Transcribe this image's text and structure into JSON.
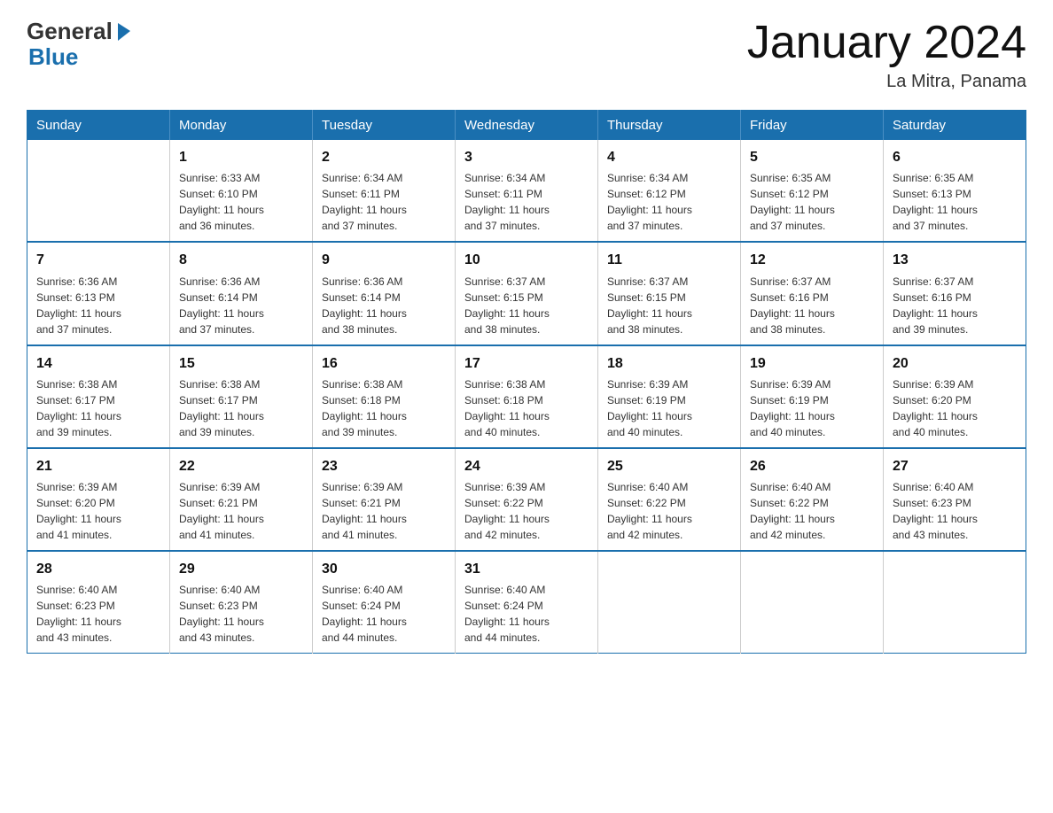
{
  "logo": {
    "general": "General",
    "blue": "Blue",
    "arrow": "▶"
  },
  "title": "January 2024",
  "subtitle": "La Mitra, Panama",
  "headers": [
    "Sunday",
    "Monday",
    "Tuesday",
    "Wednesday",
    "Thursday",
    "Friday",
    "Saturday"
  ],
  "weeks": [
    [
      {
        "day": "",
        "info": ""
      },
      {
        "day": "1",
        "info": "Sunrise: 6:33 AM\nSunset: 6:10 PM\nDaylight: 11 hours\nand 36 minutes."
      },
      {
        "day": "2",
        "info": "Sunrise: 6:34 AM\nSunset: 6:11 PM\nDaylight: 11 hours\nand 37 minutes."
      },
      {
        "day": "3",
        "info": "Sunrise: 6:34 AM\nSunset: 6:11 PM\nDaylight: 11 hours\nand 37 minutes."
      },
      {
        "day": "4",
        "info": "Sunrise: 6:34 AM\nSunset: 6:12 PM\nDaylight: 11 hours\nand 37 minutes."
      },
      {
        "day": "5",
        "info": "Sunrise: 6:35 AM\nSunset: 6:12 PM\nDaylight: 11 hours\nand 37 minutes."
      },
      {
        "day": "6",
        "info": "Sunrise: 6:35 AM\nSunset: 6:13 PM\nDaylight: 11 hours\nand 37 minutes."
      }
    ],
    [
      {
        "day": "7",
        "info": "Sunrise: 6:36 AM\nSunset: 6:13 PM\nDaylight: 11 hours\nand 37 minutes."
      },
      {
        "day": "8",
        "info": "Sunrise: 6:36 AM\nSunset: 6:14 PM\nDaylight: 11 hours\nand 37 minutes."
      },
      {
        "day": "9",
        "info": "Sunrise: 6:36 AM\nSunset: 6:14 PM\nDaylight: 11 hours\nand 38 minutes."
      },
      {
        "day": "10",
        "info": "Sunrise: 6:37 AM\nSunset: 6:15 PM\nDaylight: 11 hours\nand 38 minutes."
      },
      {
        "day": "11",
        "info": "Sunrise: 6:37 AM\nSunset: 6:15 PM\nDaylight: 11 hours\nand 38 minutes."
      },
      {
        "day": "12",
        "info": "Sunrise: 6:37 AM\nSunset: 6:16 PM\nDaylight: 11 hours\nand 38 minutes."
      },
      {
        "day": "13",
        "info": "Sunrise: 6:37 AM\nSunset: 6:16 PM\nDaylight: 11 hours\nand 39 minutes."
      }
    ],
    [
      {
        "day": "14",
        "info": "Sunrise: 6:38 AM\nSunset: 6:17 PM\nDaylight: 11 hours\nand 39 minutes."
      },
      {
        "day": "15",
        "info": "Sunrise: 6:38 AM\nSunset: 6:17 PM\nDaylight: 11 hours\nand 39 minutes."
      },
      {
        "day": "16",
        "info": "Sunrise: 6:38 AM\nSunset: 6:18 PM\nDaylight: 11 hours\nand 39 minutes."
      },
      {
        "day": "17",
        "info": "Sunrise: 6:38 AM\nSunset: 6:18 PM\nDaylight: 11 hours\nand 40 minutes."
      },
      {
        "day": "18",
        "info": "Sunrise: 6:39 AM\nSunset: 6:19 PM\nDaylight: 11 hours\nand 40 minutes."
      },
      {
        "day": "19",
        "info": "Sunrise: 6:39 AM\nSunset: 6:19 PM\nDaylight: 11 hours\nand 40 minutes."
      },
      {
        "day": "20",
        "info": "Sunrise: 6:39 AM\nSunset: 6:20 PM\nDaylight: 11 hours\nand 40 minutes."
      }
    ],
    [
      {
        "day": "21",
        "info": "Sunrise: 6:39 AM\nSunset: 6:20 PM\nDaylight: 11 hours\nand 41 minutes."
      },
      {
        "day": "22",
        "info": "Sunrise: 6:39 AM\nSunset: 6:21 PM\nDaylight: 11 hours\nand 41 minutes."
      },
      {
        "day": "23",
        "info": "Sunrise: 6:39 AM\nSunset: 6:21 PM\nDaylight: 11 hours\nand 41 minutes."
      },
      {
        "day": "24",
        "info": "Sunrise: 6:39 AM\nSunset: 6:22 PM\nDaylight: 11 hours\nand 42 minutes."
      },
      {
        "day": "25",
        "info": "Sunrise: 6:40 AM\nSunset: 6:22 PM\nDaylight: 11 hours\nand 42 minutes."
      },
      {
        "day": "26",
        "info": "Sunrise: 6:40 AM\nSunset: 6:22 PM\nDaylight: 11 hours\nand 42 minutes."
      },
      {
        "day": "27",
        "info": "Sunrise: 6:40 AM\nSunset: 6:23 PM\nDaylight: 11 hours\nand 43 minutes."
      }
    ],
    [
      {
        "day": "28",
        "info": "Sunrise: 6:40 AM\nSunset: 6:23 PM\nDaylight: 11 hours\nand 43 minutes."
      },
      {
        "day": "29",
        "info": "Sunrise: 6:40 AM\nSunset: 6:23 PM\nDaylight: 11 hours\nand 43 minutes."
      },
      {
        "day": "30",
        "info": "Sunrise: 6:40 AM\nSunset: 6:24 PM\nDaylight: 11 hours\nand 44 minutes."
      },
      {
        "day": "31",
        "info": "Sunrise: 6:40 AM\nSunset: 6:24 PM\nDaylight: 11 hours\nand 44 minutes."
      },
      {
        "day": "",
        "info": ""
      },
      {
        "day": "",
        "info": ""
      },
      {
        "day": "",
        "info": ""
      }
    ]
  ]
}
